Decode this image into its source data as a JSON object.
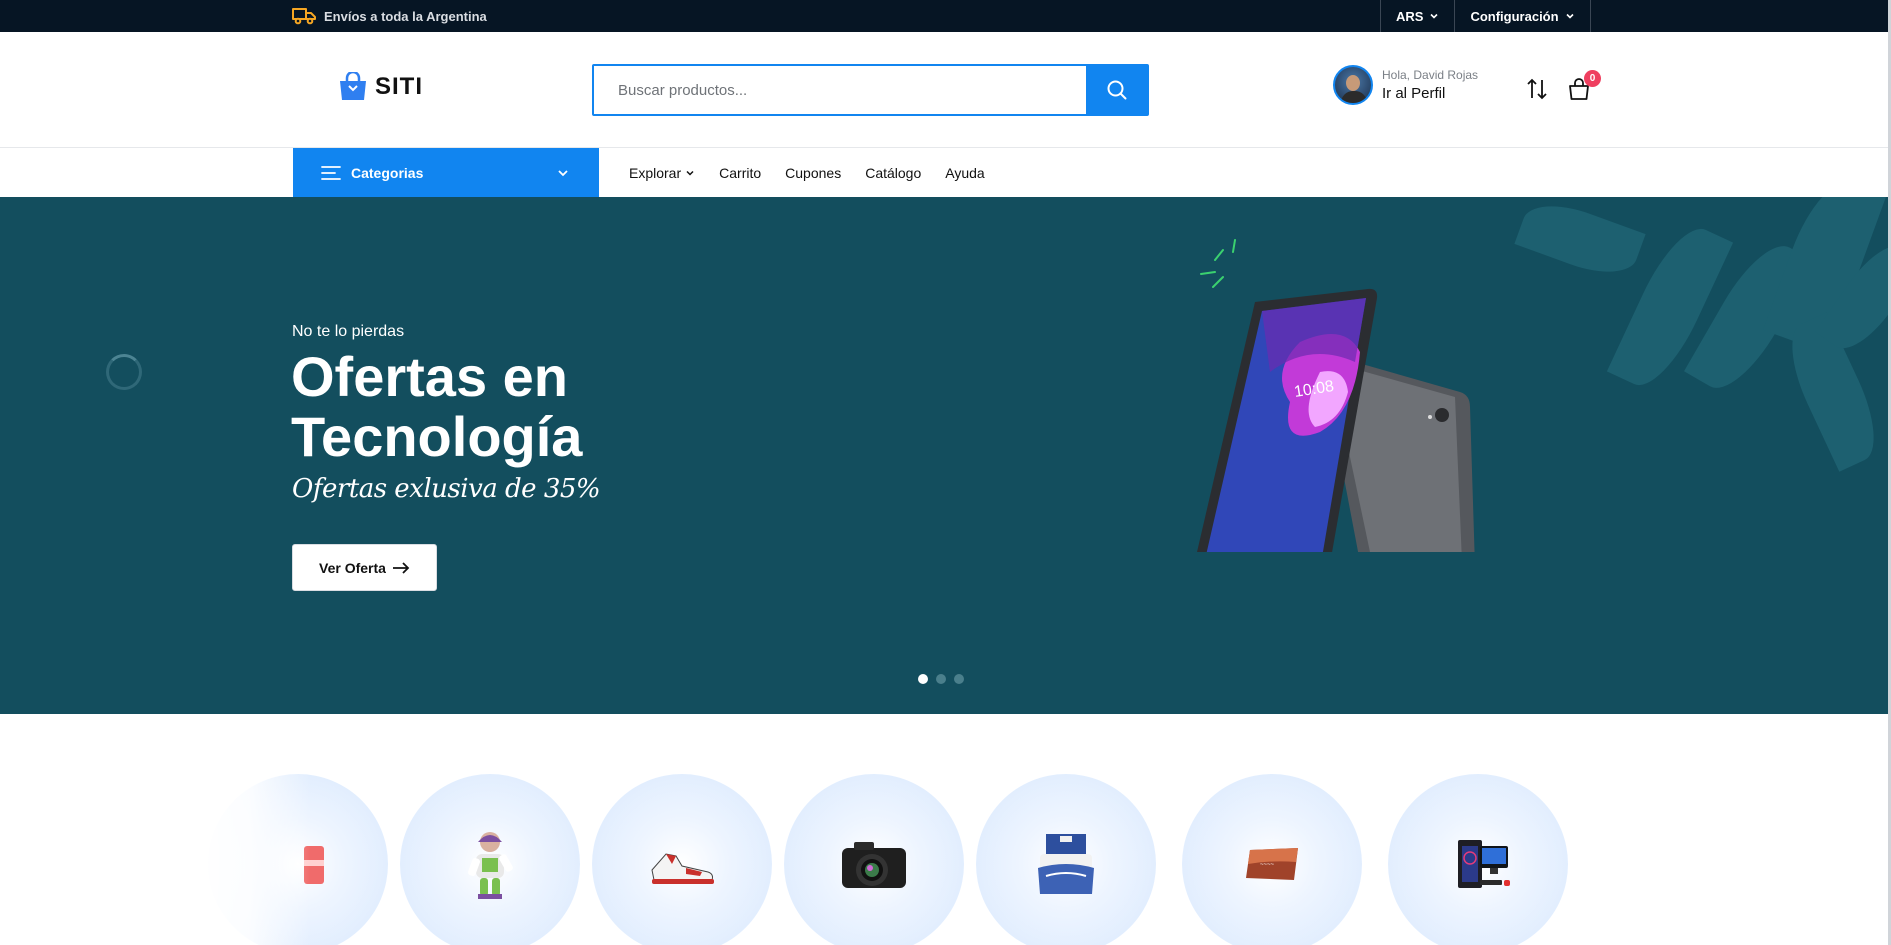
{
  "topbar": {
    "shipping": "Envíos a toda la Argentina",
    "currency": "ARS",
    "settings": "Configuración"
  },
  "header": {
    "logo_text": "SITI",
    "search_placeholder": "Buscar productos...",
    "greeting": "Hola, David Rojas",
    "profile_link": "Ir al Perfil",
    "cart_count": "0"
  },
  "nav": {
    "categories_label": "Categorias",
    "links": [
      "Explorar",
      "Carrito",
      "Cupones",
      "Catálogo",
      "Ayuda"
    ]
  },
  "hero": {
    "eyebrow": "No te lo pierdas",
    "title": "Ofertas en Tecnología",
    "subtitle": "Ofertas exlusiva de 35%",
    "cta": "Ver Oferta",
    "slides_total": 3,
    "slide_active": 1
  },
  "categories": {
    "icons": [
      "gift-icon",
      "toy-figure-icon",
      "sneaker-icon",
      "camera-icon",
      "bedding-icon",
      "painting-icon",
      "desktop-computer-icon"
    ]
  },
  "colors": {
    "accent": "#1185f0",
    "topbar_bg": "#061524",
    "hero_bg": "#134e5e",
    "badge": "#ef3f5f"
  }
}
